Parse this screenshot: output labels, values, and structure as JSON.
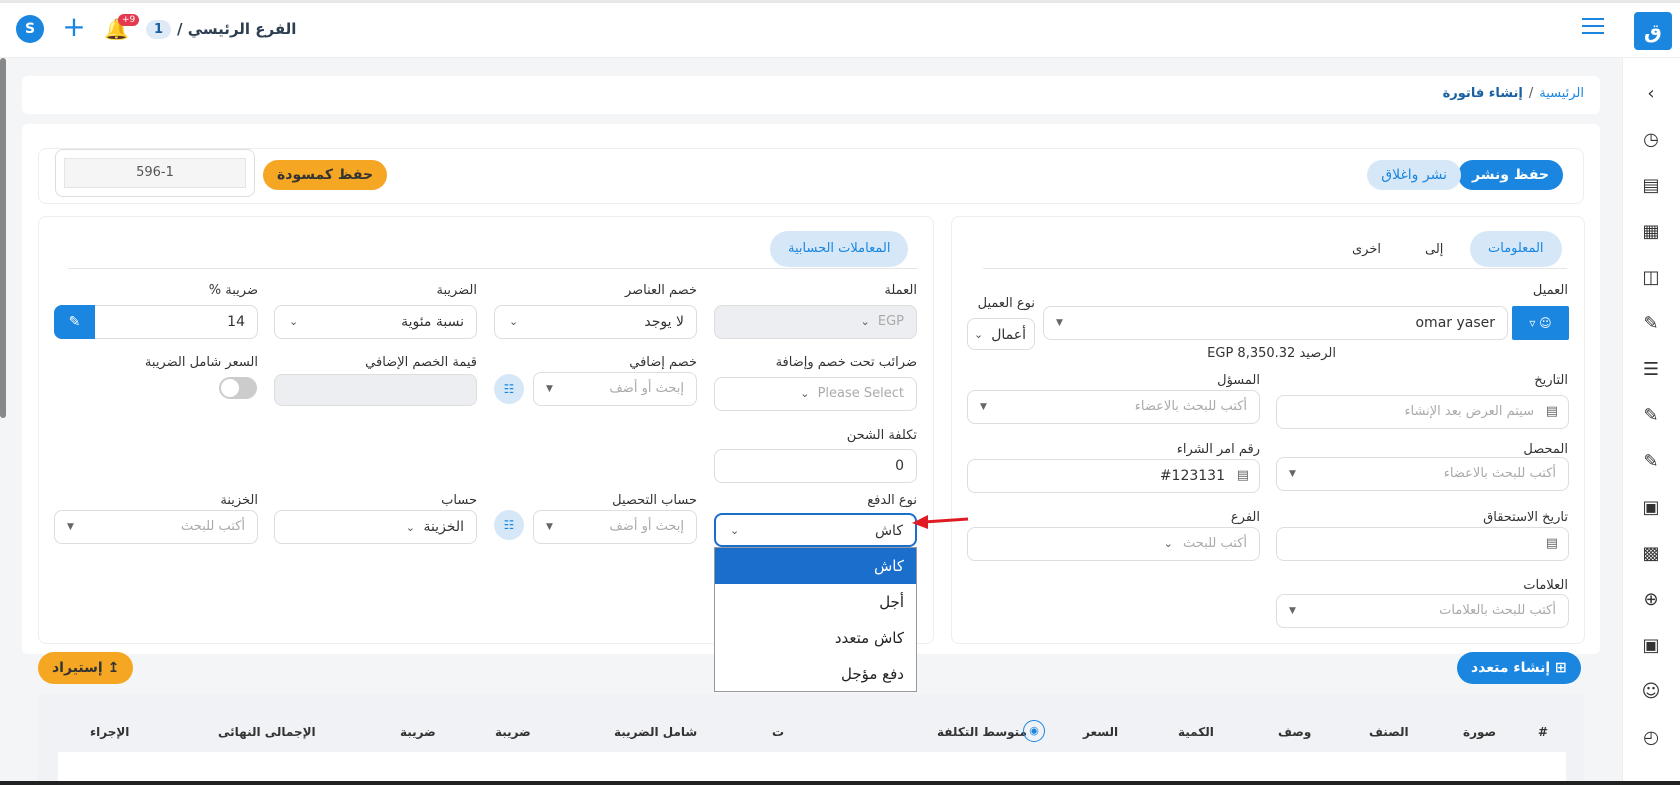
{
  "topbar": {
    "branch_badge": "1",
    "branch_name": "الفرع الرئيسي /",
    "notif_count": "+9"
  },
  "breadcrumb": {
    "home": "الرئيسية",
    "sep": "/",
    "current": "إنشاء فاتورة"
  },
  "actions": {
    "save_publish": "حفظ ونشر",
    "publish_close": "نشر واغلاق",
    "save_draft": "حفظ كمسودة",
    "invoice_no": "596-1"
  },
  "info_panel": {
    "tabs": [
      "المعلومات",
      "إلى",
      "اخرى"
    ],
    "client_label": "العميل",
    "client_value": "omar yaser",
    "client_type_label": "نوع العميل",
    "client_type_value": "أعمال",
    "balance": "الرصيد EGP 8,350.32",
    "date_label": "التاريخ",
    "date_placeholder": "سيتم العرض بعد الإنشاء",
    "responsible_label": "المسؤل",
    "responsible_placeholder": "أكتب للبحث بالاعضاء",
    "collector_label": "المحصل",
    "collector_placeholder": "أكتب للبحث بالاعضاء",
    "po_label": "رقم امر الشراء",
    "po_value": "#123131",
    "due_label": "تاريخ الاستحقاق",
    "branch_label": "الفرع",
    "branch_placeholder": "أكتب للبحث",
    "tags_label": "العلامات",
    "tags_placeholder": "أكتب للبحث بالعلامات"
  },
  "calc_panel": {
    "tab": "المعاملات الحسابية",
    "currency_label": "العملة",
    "currency_value": "EGP",
    "items_discount_label": "خصم العناصر",
    "items_discount_value": "لا يوجد",
    "tax_label": "الضريبة",
    "tax_value": "نسبة مئوية",
    "tax_pct_label": "ضريبة %",
    "tax_pct_value": "14",
    "taxes_under_label": "ضرائب تحت خصم وإضافة",
    "taxes_under_placeholder": "Please Select",
    "extra_discount_label": "خصم إضافي",
    "extra_discount_placeholder": "إبحث أو أضف",
    "extra_discount_value_label": "قيمة الخصم الإضافي",
    "price_incl_tax_label": "السعر شامل الضريبة",
    "shipping_label": "تكلفة الشحن",
    "shipping_value": "0",
    "payment_type_label": "نوع الدفع",
    "payment_type_value": "كاش",
    "collection_account_label": "حساب التحصيل",
    "collection_account_placeholder": "إبحث أو أضف",
    "account_label": "حساب",
    "account_value": "الخزينة",
    "treasury_label": "الخزينة",
    "treasury_placeholder": "أكتب للبحث"
  },
  "payment_dropdown": [
    "كاش",
    "أجل",
    "كاش متعدد",
    "دفع مؤجل"
  ],
  "bulk": {
    "create_multi": "إنشاء متعدد",
    "import": "إستيراد"
  },
  "table_headers": [
    "#",
    "صورة",
    "الصنف",
    "وصف",
    "الكمية",
    "السعر",
    "متوسط التكلفة",
    "ت",
    "شامل الضريبة",
    "ضريبة",
    "ضريبة",
    "الإجمالى النهائى",
    "الإجراء"
  ],
  "colors": {
    "accent": "#1a86e0",
    "orange": "#f5a623",
    "selected": "#1a6fcc",
    "arrow": "#e01b24"
  }
}
